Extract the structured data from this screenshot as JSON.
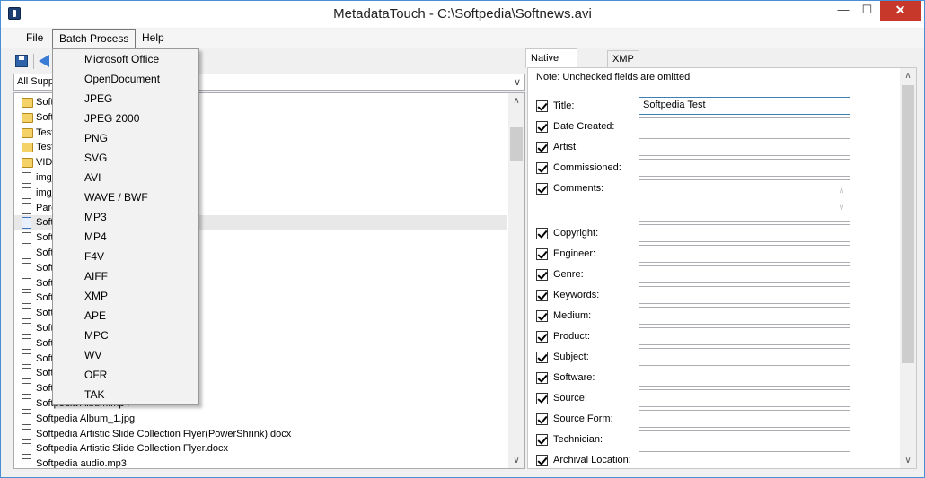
{
  "window": {
    "title": "MetadataTouch - C:\\Softpedia\\Softnews.avi"
  },
  "menu": {
    "file": "File",
    "batch": "Batch Process",
    "help": "Help"
  },
  "filter": {
    "value": "All Supp"
  },
  "files": [
    {
      "name": "Softp",
      "type": "folder"
    },
    {
      "name": "Softp",
      "type": "folder"
    },
    {
      "name": "Test",
      "type": "folder"
    },
    {
      "name": "Test",
      "type": "folder"
    },
    {
      "name": "VIDE",
      "type": "folder"
    },
    {
      "name": "img_",
      "type": "doc"
    },
    {
      "name": "img_",
      "type": "doc"
    },
    {
      "name": "Pare",
      "type": "doc"
    },
    {
      "name": "Softp",
      "type": "doc",
      "selected": true
    },
    {
      "name": "Softp",
      "type": "doc"
    },
    {
      "name": "Softp",
      "type": "doc"
    },
    {
      "name": "Softp",
      "type": "doc"
    },
    {
      "name": "Softp",
      "type": "doc"
    },
    {
      "name": "Softp",
      "type": "doc"
    },
    {
      "name": "Softp",
      "type": "doc"
    },
    {
      "name": "Softp",
      "type": "doc"
    },
    {
      "name": "Softp",
      "type": "doc"
    },
    {
      "name": "Softp",
      "type": "doc"
    },
    {
      "name": "Softp",
      "type": "doc"
    },
    {
      "name": "Softp",
      "type": "doc"
    },
    {
      "name": "Softpedia Album.mp4",
      "type": "doc"
    },
    {
      "name": "Softpedia Album_1.jpg",
      "type": "doc"
    },
    {
      "name": "Softpedia Artistic Slide Collection Flyer(PowerShrink).docx",
      "type": "doc"
    },
    {
      "name": "Softpedia Artistic Slide Collection Flyer.docx",
      "type": "doc"
    },
    {
      "name": "Softpedia audio.mp3",
      "type": "doc"
    }
  ],
  "batch_menu": [
    "Microsoft Office",
    "OpenDocument",
    "JPEG",
    "JPEG 2000",
    "PNG",
    "SVG",
    "AVI",
    "WAVE / BWF",
    "MP3",
    "MP4",
    "F4V",
    "AIFF",
    "XMP",
    "APE",
    "MPC",
    "WV",
    "OFR",
    "TAK"
  ],
  "tabs": {
    "native": "Native Metadata",
    "xmp": "XMP"
  },
  "note": "Note: Unchecked fields are omitted",
  "fields": [
    {
      "label": "Title:",
      "value": "Softpedia Test"
    },
    {
      "label": "Date Created:",
      "value": ""
    },
    {
      "label": "Artist:",
      "value": ""
    },
    {
      "label": "Commissioned:",
      "value": ""
    },
    {
      "label": "Comments:",
      "value": ""
    },
    {
      "label": "Copyright:",
      "value": ""
    },
    {
      "label": "Engineer:",
      "value": ""
    },
    {
      "label": "Genre:",
      "value": ""
    },
    {
      "label": "Keywords:",
      "value": ""
    },
    {
      "label": "Medium:",
      "value": ""
    },
    {
      "label": "Product:",
      "value": ""
    },
    {
      "label": "Subject:",
      "value": ""
    },
    {
      "label": "Software:",
      "value": ""
    },
    {
      "label": "Source:",
      "value": ""
    },
    {
      "label": "Source Form:",
      "value": ""
    },
    {
      "label": "Technician:",
      "value": ""
    },
    {
      "label": "Archival Location:",
      "value": ""
    }
  ]
}
